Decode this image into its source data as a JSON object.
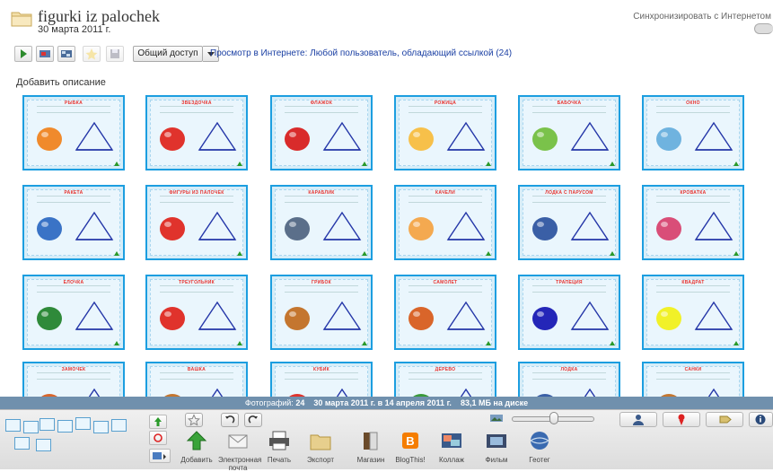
{
  "album": {
    "title": "figurki iz palochek",
    "date": "30 марта 2011 г."
  },
  "sync": {
    "label": "Синхронизировать с Интернетом"
  },
  "toolbar": {
    "share_label": "Общий доступ",
    "web_link": "Просмотр в Интернете: Любой пользователь, обладающий ссылкой (24)"
  },
  "add_description": "Добавить описание",
  "photos": [
    {
      "title": "РЫБКА"
    },
    {
      "title": "ЗВЕЗДОЧКА"
    },
    {
      "title": "ФЛАЖОК"
    },
    {
      "title": "РОЖИЦА"
    },
    {
      "title": "БАБОЧКА"
    },
    {
      "title": "ОКНО"
    },
    {
      "title": "РАКЕТА"
    },
    {
      "title": "ФИГУРЫ ИЗ ПАЛОЧЕК"
    },
    {
      "title": "КАРАБЛИК"
    },
    {
      "title": "КАЧЕЛИ"
    },
    {
      "title": "ЛОДКА С ПАРУСОМ"
    },
    {
      "title": "КРОВАТКА"
    },
    {
      "title": "ЕЛОЧКА"
    },
    {
      "title": "ТРЕУГОЛЬНИК"
    },
    {
      "title": "ГРИБОК"
    },
    {
      "title": "САМОЛЕТ"
    },
    {
      "title": "ТРАПЕЦИЯ"
    },
    {
      "title": "КВАДРАТ"
    },
    {
      "title": "ЗАМОЧЕК"
    },
    {
      "title": "ВАШКА"
    },
    {
      "title": "КУБИК"
    },
    {
      "title": "ДЕРЕВО"
    },
    {
      "title": "ЛОДКА"
    },
    {
      "title": "САНКИ"
    }
  ],
  "status": {
    "photos_label": "Фотографий:",
    "photos_count": "24",
    "date_range": "30 марта 2011 г. в 14 апреля 2011 г.",
    "disk": "83,1 МБ на диске"
  },
  "actions": [
    {
      "label": "Добавить",
      "icon": "green-up-arrow-icon"
    },
    {
      "label": "Электронная почта",
      "icon": "envelope-icon"
    },
    {
      "label": "Печать",
      "icon": "printer-icon"
    },
    {
      "label": "Экспорт",
      "icon": "folder-icon"
    },
    {
      "label": "Магазин",
      "icon": "shop-icon"
    },
    {
      "label": "BlogThis!",
      "icon": "blogger-icon"
    },
    {
      "label": "Коллаж",
      "icon": "collage-icon"
    },
    {
      "label": "Фильм",
      "icon": "film-icon"
    },
    {
      "label": "Геотег",
      "icon": "globe-icon"
    }
  ],
  "colors": {
    "thumb_border": "#1c9ee0",
    "status_bar": "#7090ad",
    "title_red": "#e8322d"
  }
}
